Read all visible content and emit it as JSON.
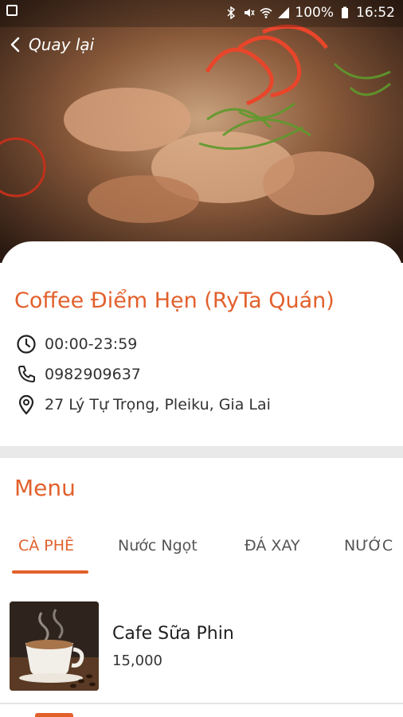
{
  "status_bar": {
    "battery": "100%",
    "time": "16:52",
    "icons": [
      "image-icon",
      "bluetooth-icon",
      "mute-icon",
      "wifi-icon",
      "signal-icon",
      "battery-icon"
    ]
  },
  "nav": {
    "back_label": "Quay lại"
  },
  "restaurant": {
    "name": "Coffee Điểm Hẹn (RyTa Quán)",
    "hours": "00:00-23:59",
    "phone": "0982909637",
    "address": "27 Lý Tự Trọng, Pleiku, Gia Lai"
  },
  "menu": {
    "title": "Menu",
    "tabs": [
      {
        "label": "CÀ PHÊ",
        "active": true
      },
      {
        "label": "Nước Ngọt",
        "active": false
      },
      {
        "label": "ĐÁ XAY",
        "active": false
      },
      {
        "label": "NƯỚC",
        "active": false
      }
    ],
    "items": [
      {
        "name": "Cafe Sữa Phin",
        "price": "15,000"
      }
    ]
  },
  "colors": {
    "accent": "#e2602c",
    "divider": "#e9e9e9"
  }
}
